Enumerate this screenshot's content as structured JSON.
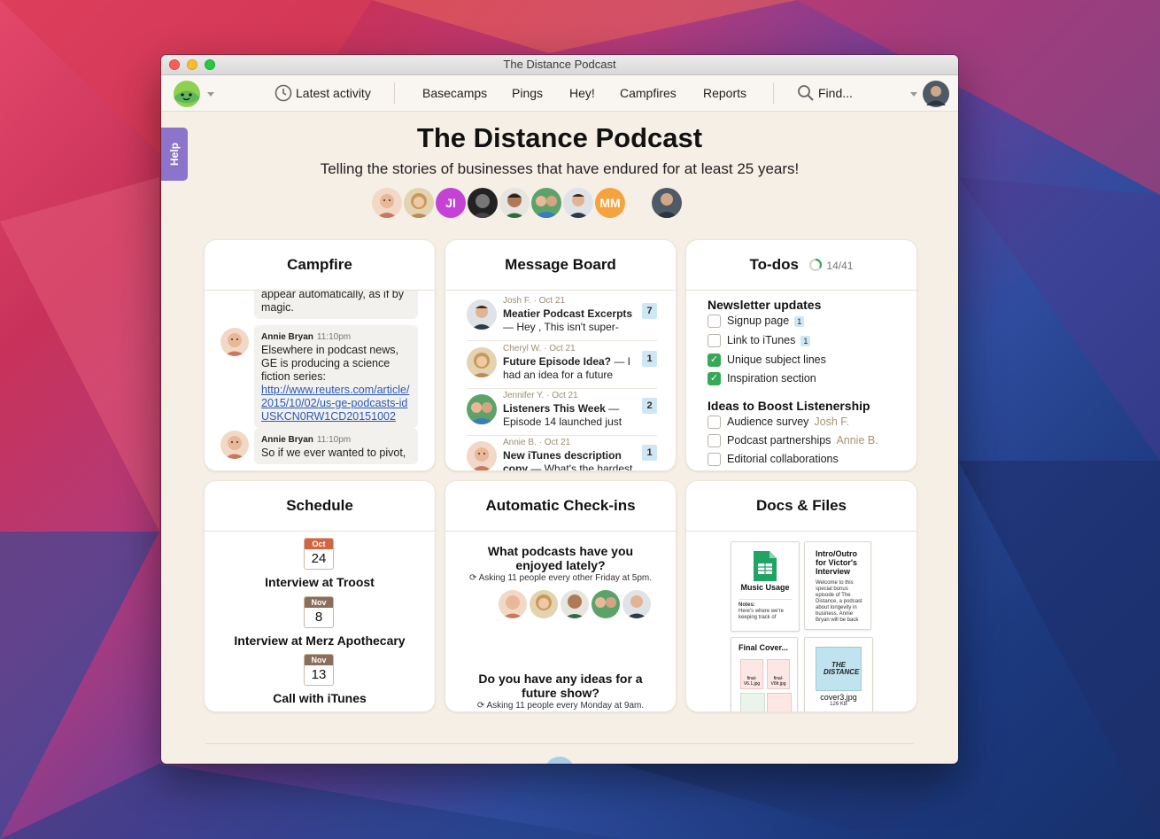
{
  "window": {
    "title": "The Distance Podcast"
  },
  "nav": {
    "latest_activity": "Latest activity",
    "basecamps": "Basecamps",
    "pings": "Pings",
    "hey": "Hey!",
    "campfires": "Campfires",
    "reports": "Reports",
    "find": "Find..."
  },
  "help": "Help",
  "project": {
    "title": "The Distance Podcast",
    "subtitle": "Telling the stories of businesses that have endured for at least 25 years!",
    "initials": [
      "JI",
      "MM"
    ]
  },
  "campfire": {
    "title": "Campfire",
    "partial_text": "appear automatically, as if by magic.",
    "messages": [
      {
        "name": "Annie Bryan",
        "time": "11:10pm",
        "text": "Elsewhere in podcast news, GE is producing a science fiction series:",
        "link": "http://www.reuters.com/article/2015/10/02/us-ge-podcasts-idUSKCN0RW1CD20151002"
      },
      {
        "name": "Annie Bryan",
        "time": "11:10pm",
        "text": "So if we ever wanted to pivot,"
      }
    ]
  },
  "message_board": {
    "title": "Message Board",
    "posts": [
      {
        "meta": "Josh F. · Oct 21",
        "title": "Meatier Podcast Excerpts",
        "excerpt": " — Hey , This isn't super-",
        "count": "7"
      },
      {
        "meta": "Cheryl W. · Oct 21",
        "title": "Future Episode Idea?",
        "excerpt": " — I had an idea for a future",
        "count": "1"
      },
      {
        "meta": "Jennifer Y. · Oct 21",
        "title": "Listeners This Week",
        "excerpt": " — Episode 14 launched just",
        "count": "2"
      },
      {
        "meta": "Annie B. · Oct 21",
        "title": "New iTunes description copy",
        "excerpt": " — What's the hardest",
        "count": "1"
      }
    ]
  },
  "todos": {
    "title": "To-dos",
    "progress": "14/41",
    "progress_fraction": 0.34,
    "accent": "#37a857",
    "lists": [
      {
        "name": "Newsletter updates",
        "items": [
          {
            "label": "Signup page",
            "done": false,
            "badge": "1"
          },
          {
            "label": "Link to iTunes",
            "done": false,
            "badge": "1"
          },
          {
            "label": "Unique subject lines",
            "done": true
          },
          {
            "label": "Inspiration section",
            "done": true
          }
        ]
      },
      {
        "name": "Ideas to Boost Listenership",
        "items": [
          {
            "label": "Audience survey",
            "done": false,
            "assignee": "Josh F."
          },
          {
            "label": "Podcast partnerships",
            "done": false,
            "assignee": "Annie B."
          },
          {
            "label": "Editorial collaborations",
            "done": false
          }
        ]
      }
    ]
  },
  "schedule": {
    "title": "Schedule",
    "events": [
      {
        "month": "Oct",
        "day": "24",
        "label": "Interview at Troost",
        "color": "#d4653f"
      },
      {
        "month": "Nov",
        "day": "8",
        "label": "Interview at Merz Apothecary",
        "color": "#8a6e5b"
      },
      {
        "month": "Nov",
        "day": "13",
        "label": "Call with iTunes",
        "color": "#8a6e5b"
      }
    ]
  },
  "checkins": {
    "title": "Automatic Check-ins",
    "questions": [
      {
        "q": "What podcasts have you enjoyed lately?",
        "sub": "Asking 11 people every other Friday at 5pm."
      },
      {
        "q": "Do you have any ideas for a future show?",
        "sub": "Asking 11 people every Monday at 9am."
      }
    ]
  },
  "docs": {
    "title": "Docs & Files",
    "files": [
      {
        "title": "Music Usage",
        "note_label": "Notes:",
        "note": "Here's where we're keeping track of"
      },
      {
        "title": "Intro/Outro for Victor's Interview",
        "text": "Welcome to this special bonus episode of The Distance, a podcast about longevity in business. Annie Bryan will be back"
      },
      {
        "title": "Final Cover...",
        "thumbs": [
          "final-V6.1.jpg",
          "final-V6fr.jpg"
        ]
      },
      {
        "title": "cover3.jpg",
        "size": "126 KB",
        "art_text": "THE DISTANCE"
      }
    ]
  },
  "colors": {
    "help_tab": "#8b74c9",
    "jl_avatar": "#c542d6",
    "mm_avatar": "#f5a33f",
    "badge": "#cfe6f5"
  }
}
